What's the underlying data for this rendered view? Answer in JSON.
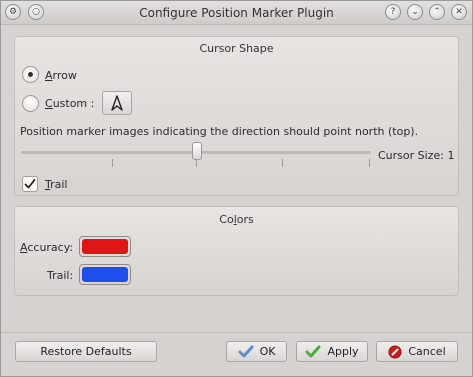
{
  "window": {
    "title": "Configure Position Marker Plugin"
  },
  "titlebar_buttons": {
    "app_icon": "gear-icon",
    "pin_icon": "circle-icon",
    "help_label": "?",
    "minimize_label": "⌄",
    "maximize_label": "⌃",
    "close_label": "✕"
  },
  "cursor_shape": {
    "title": "Cursor Shape",
    "arrow_label": "Arrow",
    "custom_label": "Custom :",
    "selected": "arrow",
    "hint": "Position marker images indicating the direction should point north (top).",
    "cursor_size_label": "Cursor Size: 1",
    "slider_value_fraction": 0.5,
    "trail_label": "Trail",
    "trail_checked": true
  },
  "colors": {
    "title": "Colors",
    "accuracy_label": "Accuracy:",
    "accuracy_color": "#e01515",
    "trail_label": "Trail:",
    "trail_color": "#1f4fea"
  },
  "buttons": {
    "restore_defaults": "Restore Defaults",
    "ok": "OK",
    "apply": "Apply",
    "cancel": "Cancel"
  }
}
